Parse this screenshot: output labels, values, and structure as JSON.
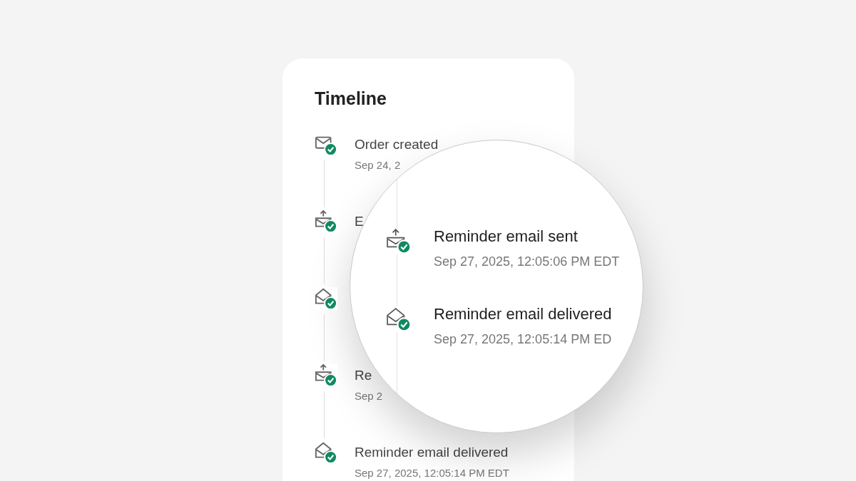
{
  "card": {
    "title": "Timeline",
    "events": [
      {
        "kind": "envelope",
        "completed": true,
        "title": "Order created",
        "time": "Sep 24, 2"
      },
      {
        "kind": "send",
        "completed": true,
        "title": "E"
      },
      {
        "kind": "open",
        "completed": true
      },
      {
        "kind": "send",
        "completed": true,
        "title": "Re",
        "time": "Sep 2"
      },
      {
        "kind": "open",
        "completed": true,
        "title": "Reminder email delivered",
        "time": "Sep 27, 2025, 12:05:14 PM EDT"
      }
    ]
  },
  "magnifier": {
    "events": [
      {
        "kind": "send",
        "completed": true,
        "title": "Reminder email sent",
        "time": "Sep 27, 2025, 12:05:06 PM EDT"
      },
      {
        "kind": "open",
        "completed": true,
        "title": "Reminder email delivered",
        "time": "Sep 27, 2025, 12:05:14 PM ED"
      }
    ]
  }
}
